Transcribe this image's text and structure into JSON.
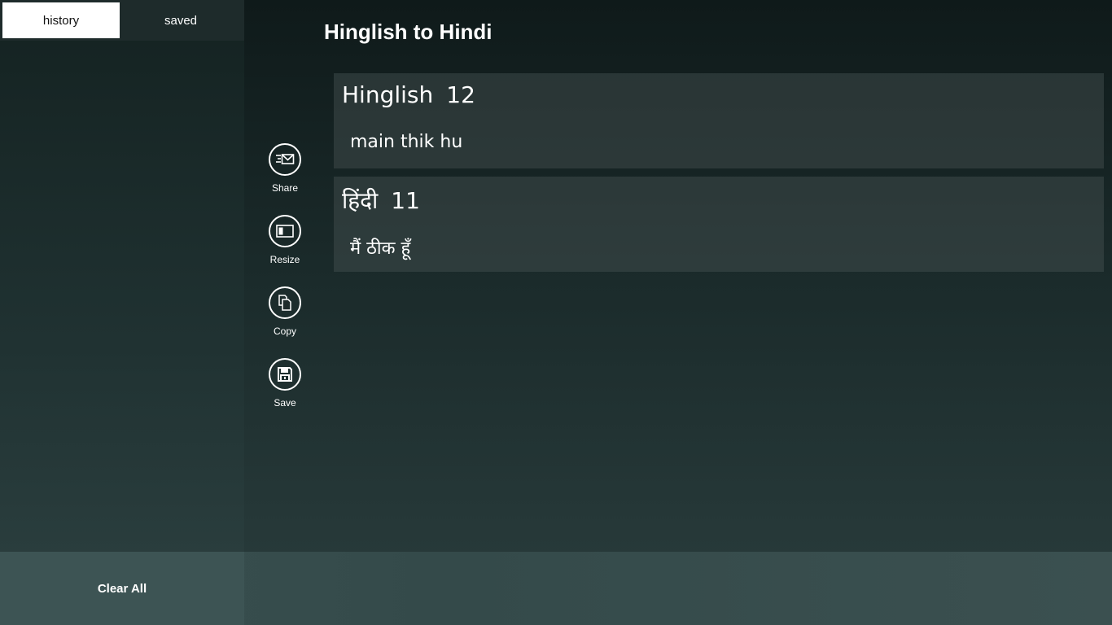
{
  "sidebar": {
    "tabs": [
      {
        "label": "history",
        "active": true
      },
      {
        "label": "saved",
        "active": false
      }
    ],
    "clear_all_label": "Clear All"
  },
  "main": {
    "title": "Hinglish to Hindi",
    "actions": [
      {
        "label": "Share",
        "icon": "share-icon"
      },
      {
        "label": "Resize",
        "icon": "resize-icon"
      },
      {
        "label": "Copy",
        "icon": "copy-icon"
      },
      {
        "label": "Save",
        "icon": "save-icon"
      }
    ],
    "source_card": {
      "language": "Hinglish",
      "count": "12",
      "text": "main thik hu"
    },
    "target_card": {
      "language": "हिंदी",
      "count": "11",
      "text": "मैं ठीक हूँ"
    }
  },
  "colors": {
    "tab_active_bg": "#ffffff",
    "card_bg": "#3a4646",
    "bottom_bar": "#3d5454"
  }
}
